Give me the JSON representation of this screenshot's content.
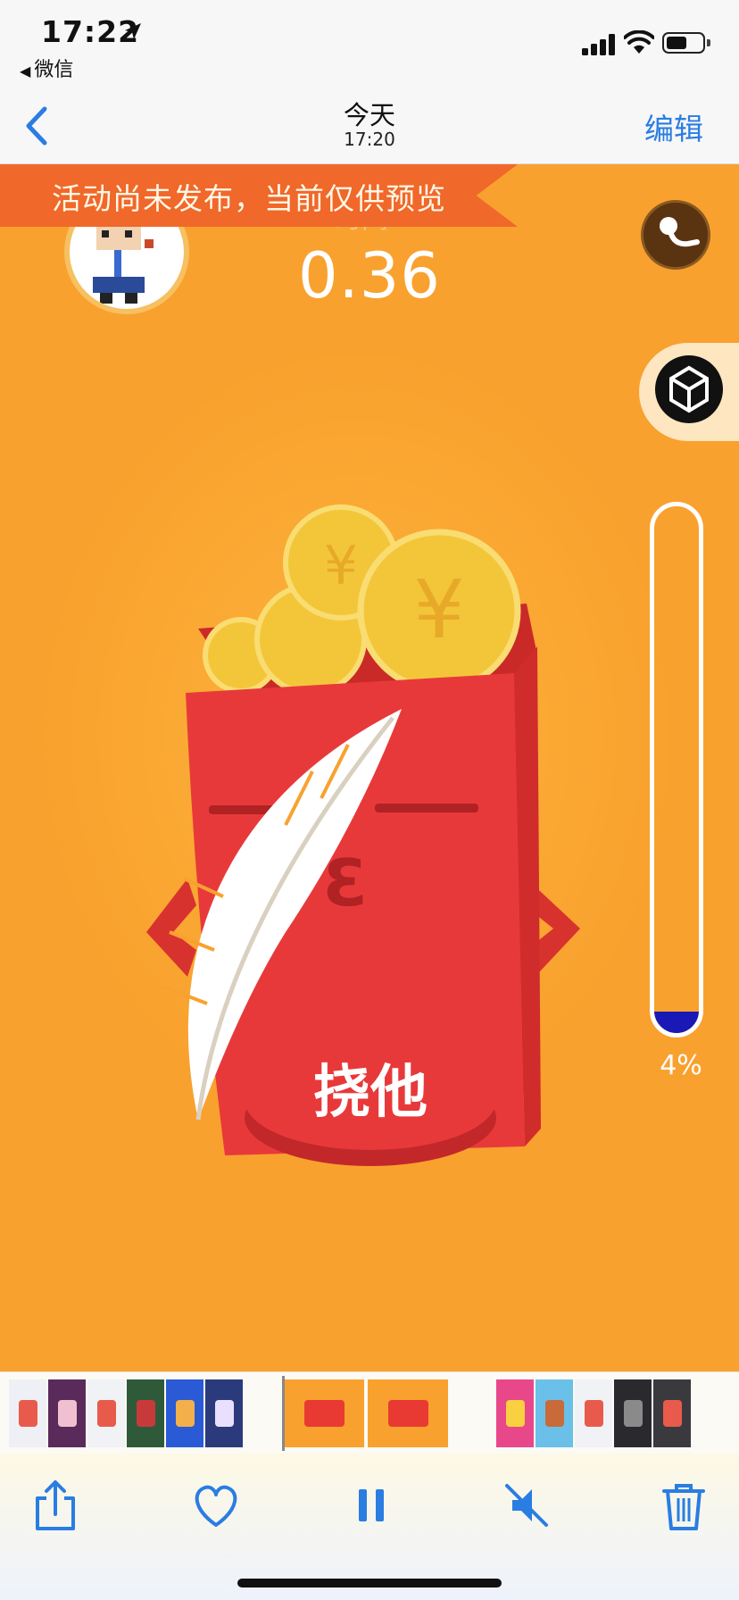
{
  "status_bar": {
    "time": "17:22",
    "back_app": "微信",
    "battery_level": 0.55
  },
  "nav": {
    "title": "今天",
    "subtitle": "17:20",
    "edit_label": "编辑"
  },
  "game": {
    "banner_text": "活动尚未发布，当前仅供预览",
    "ghost_label": "时间",
    "score": "0.36",
    "meter_percent": 4,
    "meter_label": "4%",
    "shoot_button_label": "挠他",
    "envelope_glyph": "3"
  },
  "thumbnails": [
    {
      "color": "#eef0f5",
      "accent": "#e85b4c"
    },
    {
      "color": "#5a2a5a",
      "accent": "#f0c0d0"
    },
    {
      "color": "#f0f2f6",
      "accent": "#e85b4c"
    },
    {
      "color": "#2f5a3a",
      "accent": "#c83a3a"
    },
    {
      "color": "#2a5ad6",
      "accent": "#f3b04a"
    },
    {
      "color": "#2b3a7a",
      "accent": "#e9e0ff"
    },
    {
      "color": "#f9a12e",
      "accent": "#e83a33"
    },
    {
      "color": "#f9a12e",
      "accent": "#e83a33"
    },
    {
      "color": "#e8488a",
      "accent": "#f8d040"
    },
    {
      "color": "#6ac0e8",
      "accent": "#c86a3a"
    },
    {
      "color": "#f0f2f6",
      "accent": "#e85b4c"
    },
    {
      "color": "#2a2a2e",
      "accent": "#8a8a8a"
    },
    {
      "color": "#3a3a3e",
      "accent": "#e85b4c"
    }
  ],
  "toolbar": {
    "icons": [
      "share-icon",
      "heart-icon",
      "pause-icon",
      "mute-icon",
      "trash-icon"
    ],
    "accent": "#2a7de1"
  }
}
